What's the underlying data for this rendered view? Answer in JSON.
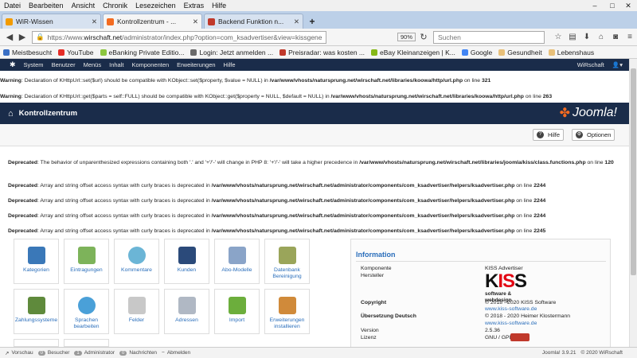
{
  "menubar": {
    "items": [
      "Datei",
      "Bearbeiten",
      "Ansicht",
      "Chronik",
      "Lesezeichen",
      "Extras",
      "Hilfe"
    ]
  },
  "window": {
    "minimize": "–",
    "maximize": "□",
    "close": "✕"
  },
  "tabs": [
    {
      "label": "WiR-Wissen",
      "color": "#f29b00"
    },
    {
      "label": "Kontrollzentrum - ...",
      "color": "#f36b21"
    },
    {
      "label": "Backend Funktion n...",
      "color": "#c0392b"
    }
  ],
  "tab_close": "✕",
  "new_tab": "+",
  "nav": {
    "url_prefix": "https://www.",
    "url_domain": "wirschaft.net",
    "url_rest": "/administrator/index.php?option=com_ksadvertiser&view=kissgene",
    "zoom": "90%",
    "search_placeholder": "Suchen"
  },
  "bookmarks": [
    {
      "label": "Meistbesucht",
      "color": "#3a6fc4"
    },
    {
      "label": "YouTube",
      "color": "#e52d27"
    },
    {
      "label": "eBanking Private Editio...",
      "color": "#8cc63f"
    },
    {
      "label": "Login: Jetzt anmelden ...",
      "color": "#6a6a6a"
    },
    {
      "label": "Preisradar: was kosten ...",
      "color": "#c0392b"
    },
    {
      "label": "eBay Kleinanzeigen | K...",
      "color": "#86b817"
    },
    {
      "label": "Google",
      "color": "#4285f4"
    },
    {
      "label": "Gesundheit",
      "color": "#e8c07a"
    },
    {
      "label": "Lebenshaus",
      "color": "#e8c07a"
    }
  ],
  "joomla_menu": {
    "items": [
      "System",
      "Benutzer",
      "Menüs",
      "Inhalt",
      "Komponenten",
      "Erweiterungen",
      "Hilfe"
    ],
    "site": "WiRschaft"
  },
  "warnings": [
    {
      "label": "Warning",
      "text": ": Declaration of KHttpUrl::set($url) should be compatible with KObject::set($property, $value = NULL) in ",
      "path": "/var/www/vhosts/natursprung.net/wirschaft.net/libraries/koowa/http/url.php",
      "line": " on line ",
      "num": "321"
    },
    {
      "label": "Warning",
      "text": ": Declaration of KHttpUrl::get($parts = self::FULL) should be compatible with KObject::get($property = NULL, $default = NULL) in ",
      "path": "/var/www/vhosts/natursprung.net/wirschaft.net/libraries/koowa/http/url.php",
      "line": " on line ",
      "num": "263"
    }
  ],
  "page_title": "Kontrollzentrum",
  "logo_text": "Joomla!",
  "toolbar": {
    "help": "Hilfe",
    "options": "Optionen"
  },
  "deprecated": [
    {
      "label": "Deprecated",
      "text": ": The behavior of unparenthesized expressions containing both '.' and '+'/'-' will change in PHP 8: '+'/'-' will take a higher precedence in ",
      "path": "/var/www/vhosts/natursprung.net/wirschaft.net/libraries/joomla/kiss/class.functions.php",
      "line": " on line ",
      "num": "120"
    },
    {
      "label": "Deprecated",
      "text": ": Array and string offset access syntax with curly braces is deprecated in ",
      "path": "/var/www/vhosts/natursprung.net/wirschaft.net/administrator/components/com_ksadvertiser/helpers/ksadvertiser.php",
      "line": " on line ",
      "num": "2244"
    },
    {
      "label": "Deprecated",
      "text": ": Array and string offset access syntax with curly braces is deprecated in ",
      "path": "/var/www/vhosts/natursprung.net/wirschaft.net/administrator/components/com_ksadvertiser/helpers/ksadvertiser.php",
      "line": " on line ",
      "num": "2244"
    },
    {
      "label": "Deprecated",
      "text": ": Array and string offset access syntax with curly braces is deprecated in ",
      "path": "/var/www/vhosts/natursprung.net/wirschaft.net/administrator/components/com_ksadvertiser/helpers/ksadvertiser.php",
      "line": " on line ",
      "num": "2244"
    },
    {
      "label": "Deprecated",
      "text": ": Array and string offset access syntax with curly braces is deprecated in ",
      "path": "/var/www/vhosts/natursprung.net/wirschaft.net/administrator/components/com_ksadvertiser/helpers/ksadvertiser.php",
      "line": " on line ",
      "num": "2245"
    }
  ],
  "icons": [
    {
      "label": "Kategorien",
      "color": "#3a78b8"
    },
    {
      "label": "Eintragungen",
      "color": "#7db35a"
    },
    {
      "label": "Kommentare",
      "color": "#6bb5d6"
    },
    {
      "label": "Kunden",
      "color": "#2b4a7a"
    },
    {
      "label": "Abo-Modelle",
      "color": "#8aa4c8"
    },
    {
      "label": "Datenbank Bereinigung",
      "color": "#9aa55a"
    },
    {
      "label": "Zahlungssysteme",
      "color": "#5f8a3c"
    },
    {
      "label": "Sprachen bearbeiten",
      "color": "#4aa0d8"
    },
    {
      "label": "Felder",
      "color": "#c8c8c8"
    },
    {
      "label": "Adressen",
      "color": "#b0b8c4"
    },
    {
      "label": "Import",
      "color": "#6cae3c"
    },
    {
      "label": "Erweiterungen installieren",
      "color": "#d08a3a"
    }
  ],
  "info": {
    "title": "Information",
    "rows": {
      "komponente_l": "Komponente",
      "komponente_v": "KISS Advertiser",
      "hersteller_l": "Hersteller",
      "copyright_l": "Copyright",
      "copyright_v1": "© 2018 - 2020 KISS Software",
      "copyright_v2": "www.kiss-software.de",
      "uebersetzung_l": "Übersetzung Deutsch",
      "uebersetzung_v1": "© 2018 - 2020 Heimer Klostermann",
      "uebersetzung_v2": "www.kiss-software.de",
      "version_l": "Version",
      "version_v": "2.5.36",
      "lizenz_l": "Lizenz",
      "lizenz_v": "GNU / GPL v3"
    },
    "kiss_logo": "KISS",
    "kiss_sub": "software & webdesign"
  },
  "status": {
    "preview": "Vorschau",
    "visitors_n": "0",
    "visitors": "Besucher",
    "admin_n": "1",
    "admin": "Administrator",
    "messages_n": "0",
    "messages": "Nachrichten",
    "logout": "Abmelden",
    "version": "Joomla! 3.9.21",
    "copyright": "© 2020 WiRschaft"
  }
}
